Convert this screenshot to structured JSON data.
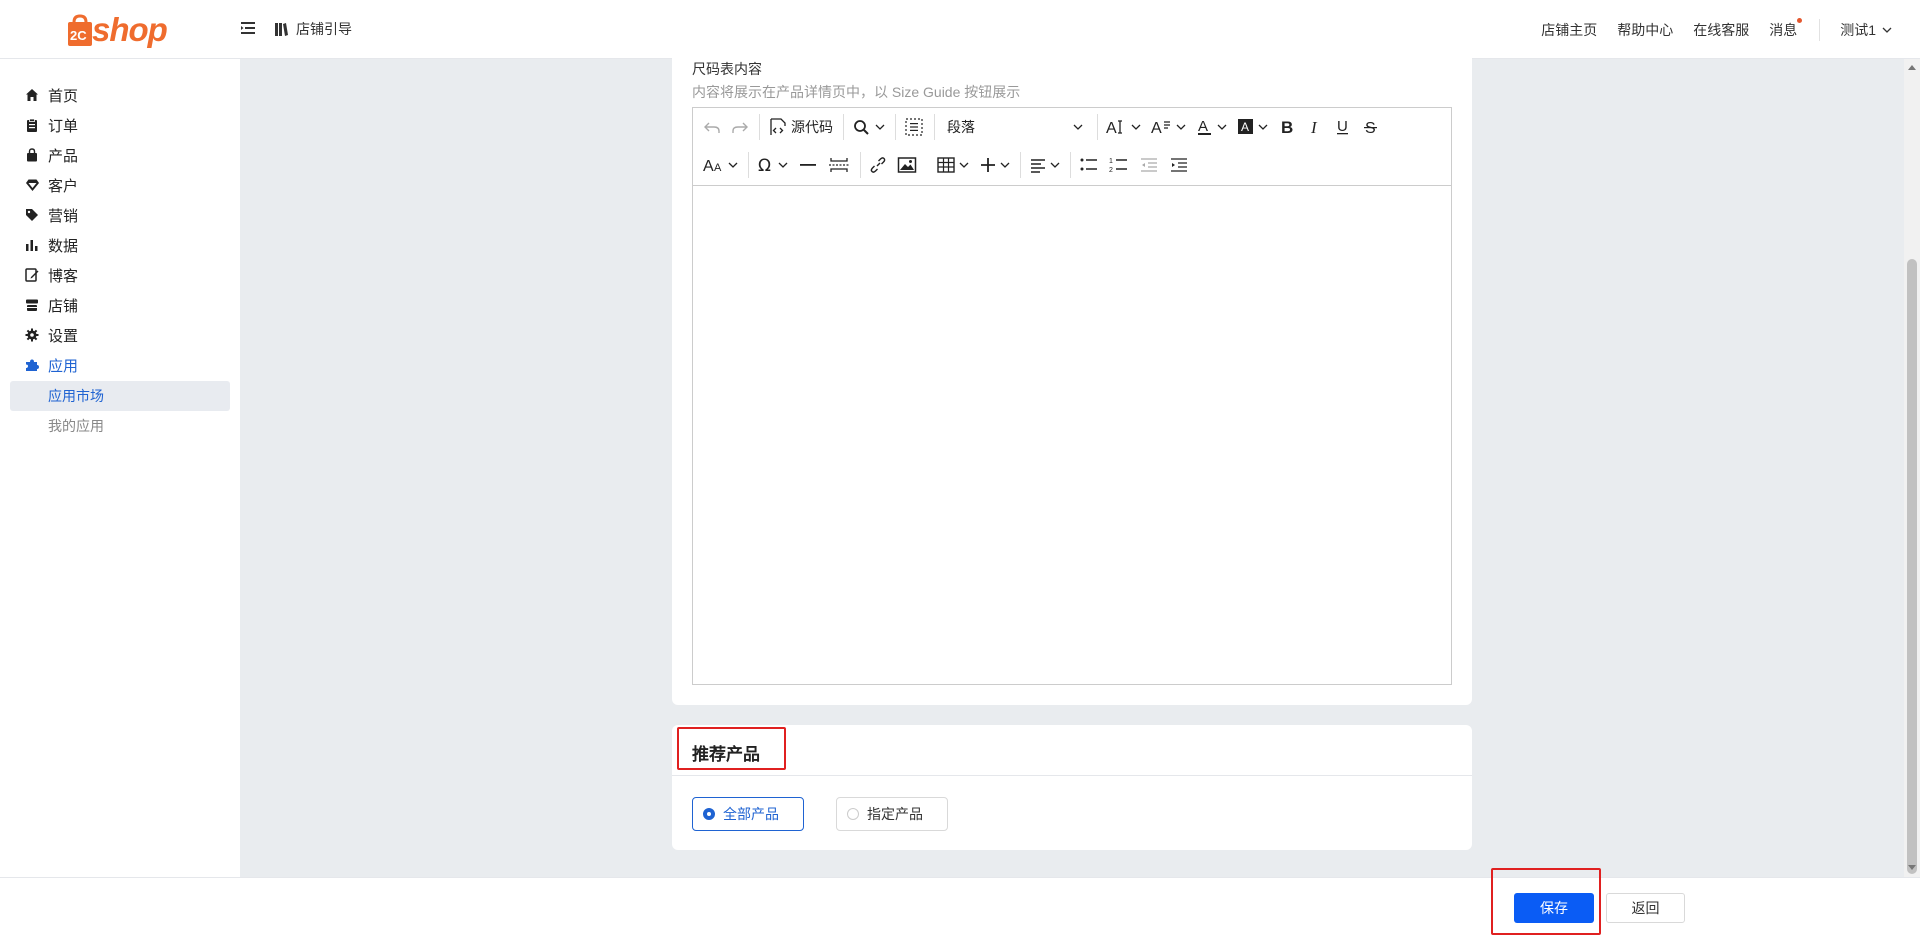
{
  "header": {
    "logo_text": "shop",
    "logo_badge": "2C",
    "guide_label": "店铺引导",
    "nav": [
      "店铺主页",
      "帮助中心",
      "在线客服",
      "消息"
    ],
    "user_name": "测试1"
  },
  "sidebar": {
    "items": [
      {
        "label": "首页",
        "icon": "home-icon"
      },
      {
        "label": "订单",
        "icon": "clipboard-icon"
      },
      {
        "label": "产品",
        "icon": "bag-icon"
      },
      {
        "label": "客户",
        "icon": "diamond-icon"
      },
      {
        "label": "营销",
        "icon": "tag-icon"
      },
      {
        "label": "数据",
        "icon": "bar-chart-icon"
      },
      {
        "label": "博客",
        "icon": "edit-icon"
      },
      {
        "label": "店铺",
        "icon": "store-icon"
      },
      {
        "label": "设置",
        "icon": "gear-icon"
      },
      {
        "label": "应用",
        "icon": "puzzle-icon"
      }
    ],
    "sub_items": [
      "应用市场",
      "我的应用"
    ]
  },
  "size_guide": {
    "title": "尺码表内容",
    "hint": "内容将展示在产品详情页中，以 Size Guide 按钮展示"
  },
  "editor": {
    "source_code_label": "源代码",
    "block_format": "段落"
  },
  "recommend": {
    "title": "推荐产品",
    "options": [
      "全部产品",
      "指定产品"
    ],
    "selected": "全部产品"
  },
  "footer": {
    "save_label": "保存",
    "back_label": "返回"
  },
  "colors": {
    "primary": "#0a5cf5",
    "brand": "#ef6c2e",
    "highlight": "#e02020"
  }
}
